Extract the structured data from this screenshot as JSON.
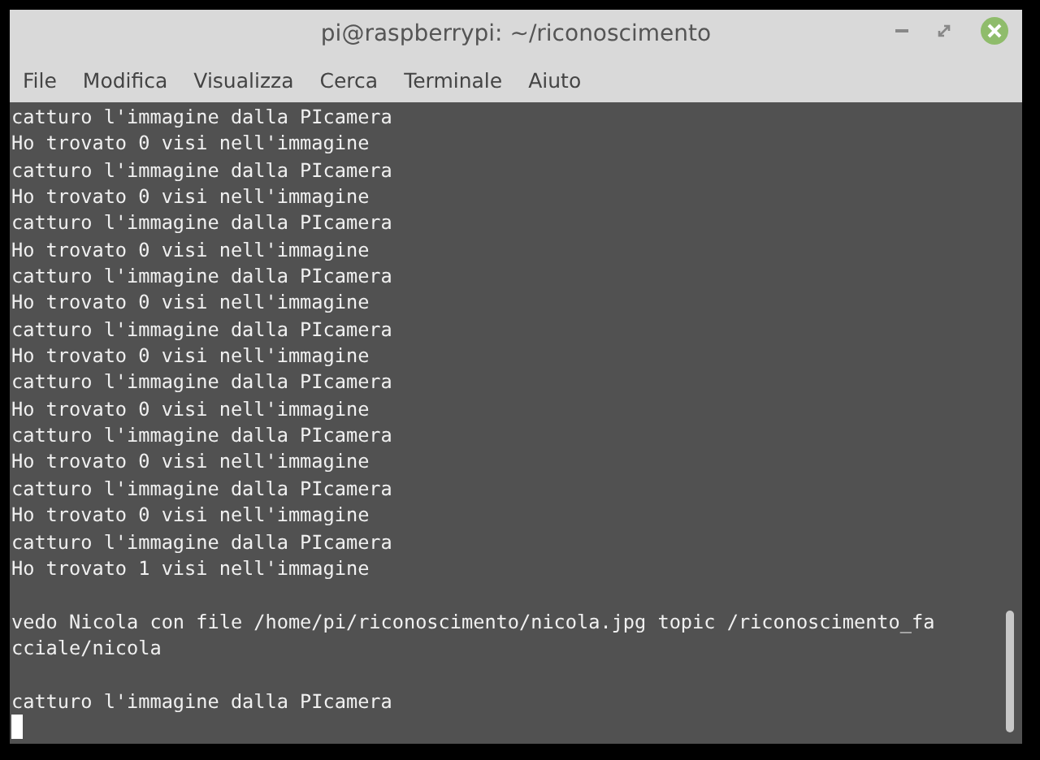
{
  "window": {
    "title": "pi@raspberrypi: ~/riconoscimento"
  },
  "menu": [
    "File",
    "Modifica",
    "Visualizza",
    "Cerca",
    "Terminale",
    "Aiuto"
  ],
  "terminal": {
    "lines": [
      {
        "kind": "line",
        "text": "catturo l'immagine dalla PIcamera"
      },
      {
        "kind": "line",
        "text": "Ho trovato 0 visi nell'immagine"
      },
      {
        "kind": "line",
        "text": "catturo l'immagine dalla PIcamera"
      },
      {
        "kind": "line",
        "text": "Ho trovato 0 visi nell'immagine"
      },
      {
        "kind": "line",
        "text": "catturo l'immagine dalla PIcamera"
      },
      {
        "kind": "line",
        "text": "Ho trovato 0 visi nell'immagine"
      },
      {
        "kind": "line",
        "text": "catturo l'immagine dalla PIcamera"
      },
      {
        "kind": "line",
        "text": "Ho trovato 0 visi nell'immagine"
      },
      {
        "kind": "line",
        "text": "catturo l'immagine dalla PIcamera"
      },
      {
        "kind": "line",
        "text": "Ho trovato 0 visi nell'immagine"
      },
      {
        "kind": "line",
        "text": "catturo l'immagine dalla PIcamera"
      },
      {
        "kind": "line",
        "text": "Ho trovato 0 visi nell'immagine"
      },
      {
        "kind": "line",
        "text": "catturo l'immagine dalla PIcamera"
      },
      {
        "kind": "line",
        "text": "Ho trovato 0 visi nell'immagine"
      },
      {
        "kind": "line",
        "text": "catturo l'immagine dalla PIcamera"
      },
      {
        "kind": "line",
        "text": "Ho trovato 0 visi nell'immagine"
      },
      {
        "kind": "line",
        "text": "catturo l'immagine dalla PIcamera"
      },
      {
        "kind": "line",
        "text": "Ho trovato 1 visi nell'immagine"
      },
      {
        "kind": "blank"
      },
      {
        "kind": "line",
        "text": "vedo Nicola con file /home/pi/riconoscimento/nicola.jpg topic /riconoscimento_fa"
      },
      {
        "kind": "line",
        "text": "cciale/nicola"
      },
      {
        "kind": "blank"
      },
      {
        "kind": "line",
        "text": "catturo l'immagine dalla PIcamera"
      },
      {
        "kind": "cursor"
      }
    ]
  }
}
